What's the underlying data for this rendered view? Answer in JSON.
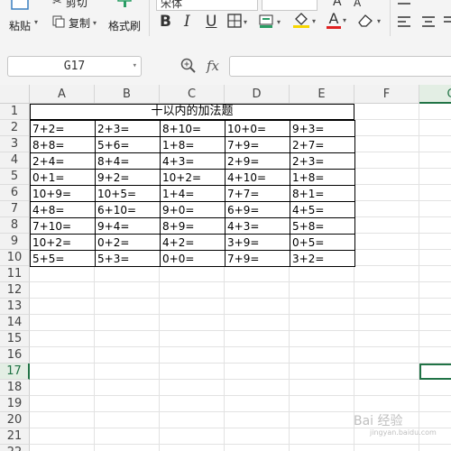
{
  "toolbar": {
    "paste_label": "粘贴",
    "cut_label": "剪切",
    "copy_label": "复制",
    "format_painter_label": "格式刷",
    "font_name": "宋体",
    "bold": "B",
    "italic": "I",
    "underline": "U",
    "font_color_letter": "A"
  },
  "formula_bar": {
    "name_box": "G17",
    "fx_label": "fx",
    "formula_value": ""
  },
  "sheet": {
    "columns": [
      "A",
      "B",
      "C",
      "D",
      "E",
      "F",
      "G"
    ],
    "rows": [
      "1",
      "2",
      "3",
      "4",
      "5",
      "6",
      "7",
      "8",
      "9",
      "10",
      "11",
      "12",
      "13",
      "14",
      "15",
      "16",
      "17",
      "18",
      "19",
      "20",
      "21",
      "22"
    ],
    "selected_column": "G",
    "selected_row": "17",
    "title": "十以内的加法题",
    "data": [
      [
        "7+2=",
        "2+3=",
        "8+10=",
        "10+0=",
        "9+3="
      ],
      [
        "8+8=",
        "5+6=",
        "1+8=",
        "7+9=",
        "2+7="
      ],
      [
        "2+4=",
        "8+4=",
        "4+3=",
        "2+9=",
        "2+3="
      ],
      [
        "0+1=",
        "9+2=",
        "10+2=",
        "4+10=",
        "1+8="
      ],
      [
        "10+9=",
        "10+5=",
        "1+4=",
        "7+7=",
        "8+1="
      ],
      [
        "4+8=",
        "6+10=",
        "9+0=",
        "6+9=",
        "4+5="
      ],
      [
        "7+10=",
        "9+4=",
        "8+9=",
        "4+3=",
        "5+8="
      ],
      [
        "10+2=",
        "0+2=",
        "4+2=",
        "3+9=",
        "0+5="
      ],
      [
        "5+5=",
        "5+3=",
        "0+0=",
        "7+9=",
        "3+2="
      ]
    ]
  },
  "watermark": {
    "text": "Bai 经验",
    "subtext": "jingyan.baidu.com"
  },
  "colors": {
    "accent": "#217346",
    "grid_line": "#e2e2e2",
    "header_bg": "#f2f2f2",
    "ribbon_bg": "#f4f4f4"
  }
}
